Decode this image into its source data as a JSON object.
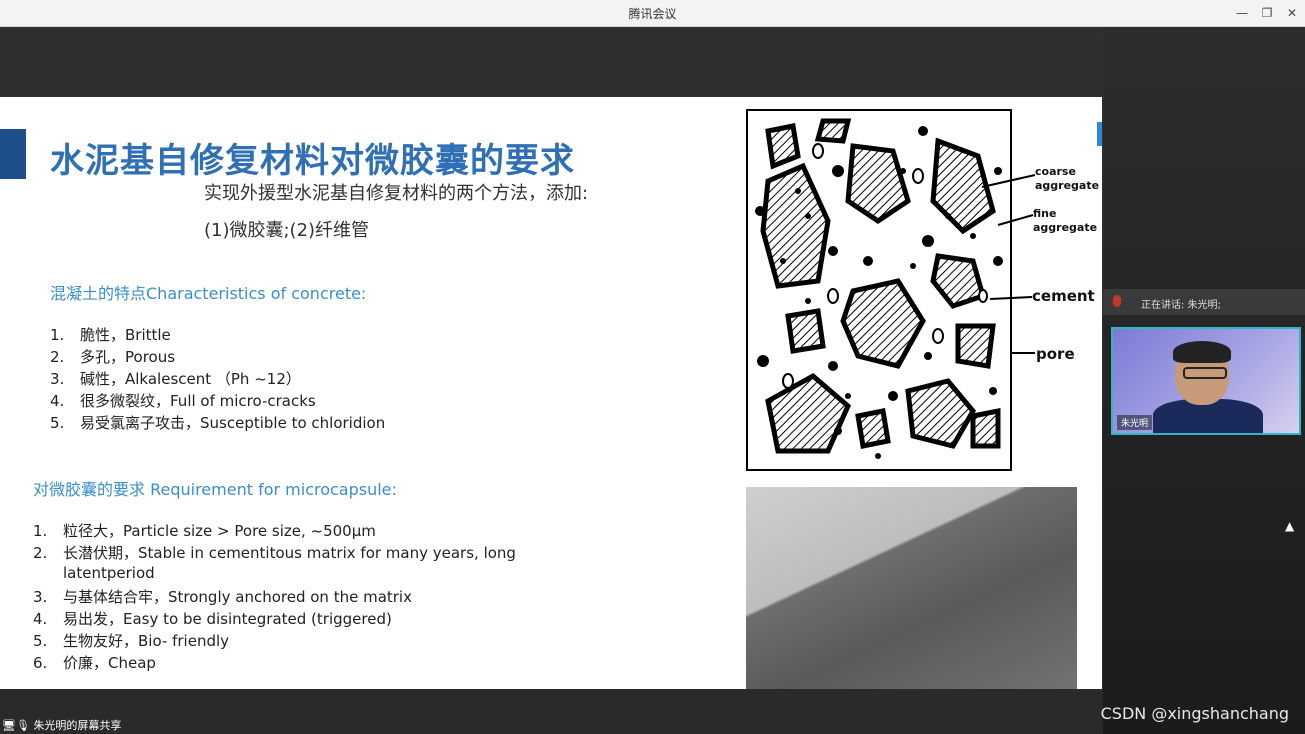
{
  "window": {
    "title": "腾讯会议"
  },
  "slide": {
    "title": "水泥基自修复材料对微胶囊的要求",
    "subtitle1": "实现外援型水泥基自修复材料的两个方法，添加:",
    "subtitle2": "(1)微胶囊;(2)纤维管",
    "section1": "混凝土的特点Characteristics of concrete:",
    "concrete": [
      {
        "n": "1.",
        "t": "脆性，Brittle"
      },
      {
        "n": "2.",
        "t": "多孔，Porous"
      },
      {
        "n": "3.",
        "t": "碱性，Alkalescent （Ph ~12）"
      },
      {
        "n": "4.",
        "t": "很多微裂纹，Full of micro-cracks"
      },
      {
        "n": "5.",
        "t": "易受氯离子攻击，Susceptible to chloridion"
      }
    ],
    "section2": "对微胶囊的要求 Requirement for microcapsule:",
    "requirements": [
      {
        "n": "1.",
        "t": "粒径大，Particle size > Pore size, ~500μm"
      },
      {
        "n": "2.",
        "t": "长潜伏期，Stable in cementitous matrix for many years, long"
      },
      {
        "n": "",
        "t": "latentperiod"
      },
      {
        "n": "3.",
        "t": "与基体结合牢，Strongly anchored on the matrix"
      },
      {
        "n": "4.",
        "t": "易出发，Easy to be disintegrated (triggered)"
      },
      {
        "n": "5.",
        "t": "生物友好，Bio- friendly"
      },
      {
        "n": "6.",
        "t": "价廉，Cheap"
      }
    ],
    "diagram_labels": {
      "coarse1": "coarse",
      "coarse2": "aggregate",
      "fine1": "fine",
      "fine2": "aggregate",
      "cement": "cement",
      "pore": "pore"
    }
  },
  "sidebar": {
    "speaking": "正在讲话: 朱光明;",
    "video_name": "朱光明"
  },
  "bottom": {
    "share_label": "朱光明的屏幕共享"
  },
  "watermark": "CSDN @xingshanchang",
  "colors": {
    "title": "#2e6fb6",
    "section": "#3a8fc9",
    "accent": "#1f4e8c",
    "video_border": "#2fb8c0"
  }
}
